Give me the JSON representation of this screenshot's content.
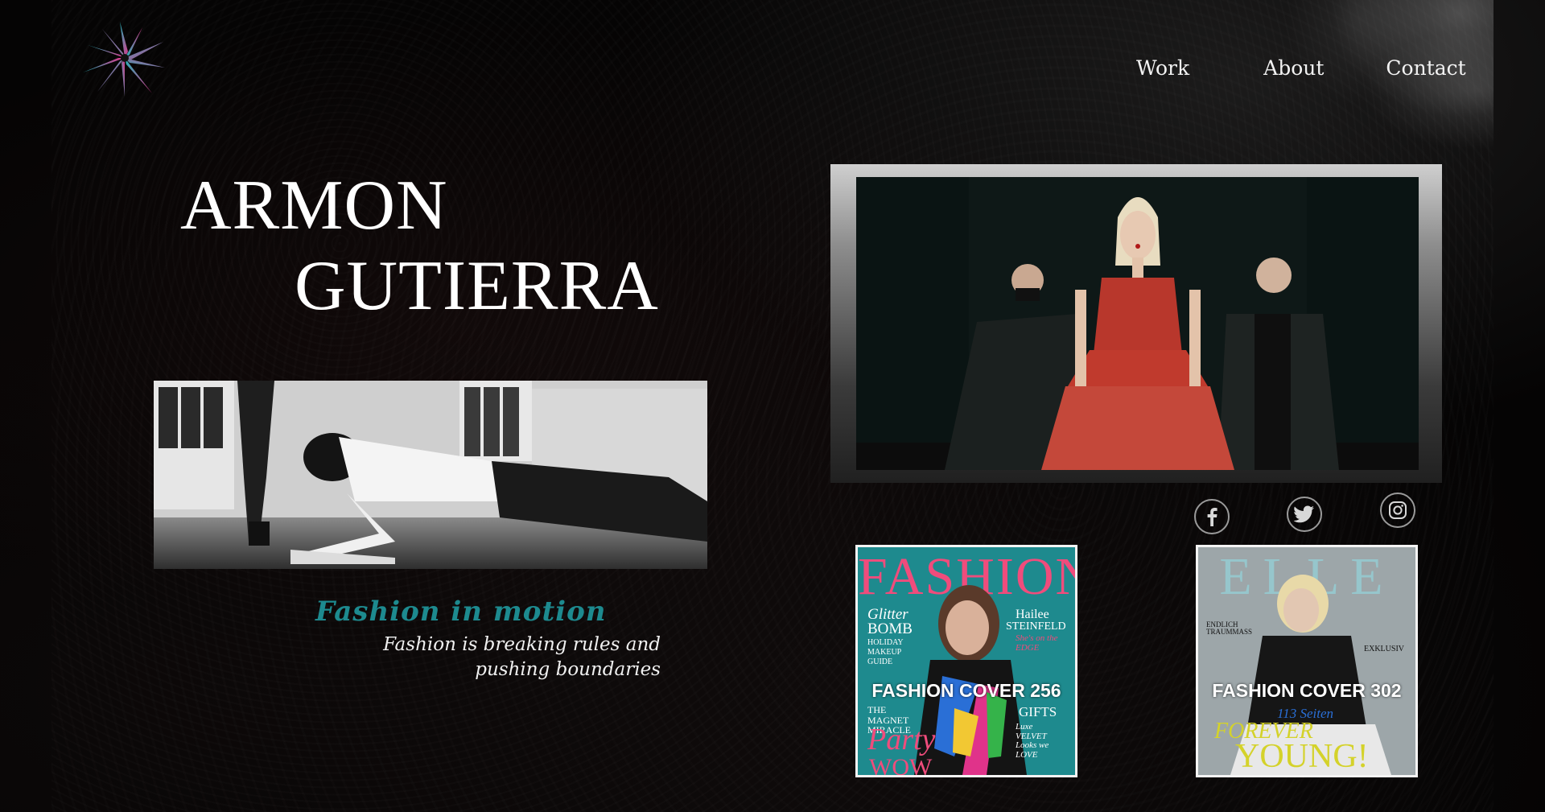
{
  "brand": {
    "logo": "starburst-logo-icon"
  },
  "nav": {
    "items": [
      {
        "label": "Work"
      },
      {
        "label": "About"
      },
      {
        "label": "Contact"
      }
    ]
  },
  "hero": {
    "name_line1": "ARMON",
    "name_line2": "GUTIERRA",
    "tagline": "Fashion in motion",
    "subtext_line1": "Fashion is breaking rules and",
    "subtext_line2": "pushing boundaries"
  },
  "social": {
    "icons": [
      "facebook-icon",
      "twitter-icon",
      "instagram-icon"
    ]
  },
  "covers": [
    {
      "masthead": "FASHION",
      "label": "FASHION COVER 256",
      "cover_text": {
        "glitter": "Glitter",
        "bomb": "BOMB",
        "holiday": "HOLIDAY",
        "makeup": "MAKEUP",
        "guide": "GUIDE",
        "name_first": "Hailee",
        "name_last": "STEINFELD",
        "edge": "She's on the EDGE",
        "magnet": "THE MAGNET MIRACLE",
        "gifts": "GIFTS",
        "party": "Party",
        "wow": "WOW",
        "velvet": "Luxe VELVET Looks we LOVE"
      }
    },
    {
      "masthead": "ELLE",
      "label": "FASHION COVER 302",
      "cover_text": {
        "endlich": "ENDLICH TRAUMMASS",
        "exklusiv": "EXKLUSIV",
        "seiten": "113 Seiten",
        "forever": "FOREVER",
        "young": "YOUNG!"
      }
    }
  ],
  "colors": {
    "accent_teal": "#1d8a8f",
    "text_white": "#f2f2f2",
    "background": "#050404"
  }
}
